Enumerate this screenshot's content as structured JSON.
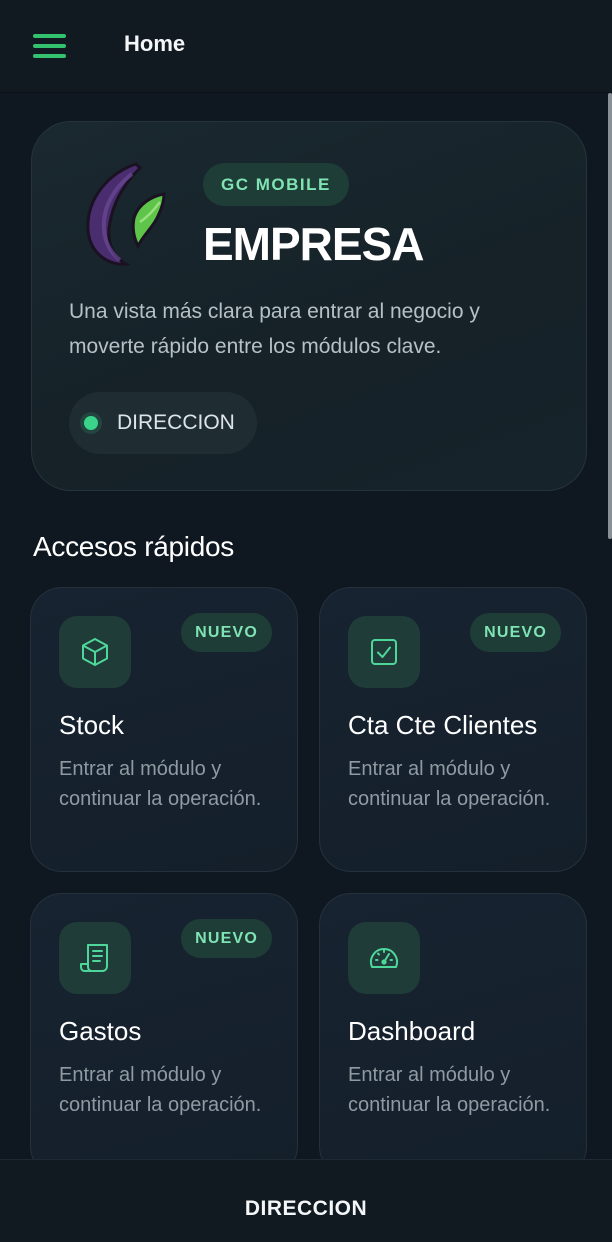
{
  "header": {
    "title": "Home",
    "menu_icon": "hamburger-menu-icon",
    "accent_color": "#33c26d"
  },
  "hero": {
    "logo_icon": "gc-logo",
    "brand_badge": "GC MOBILE",
    "title": "EMPRESA",
    "description": "Una vista más clara para entrar al negocio y moverte rápido entre los módulos clave.",
    "role_label": "DIRECCION",
    "role_status_color": "#3bd38a"
  },
  "quick_access": {
    "title": "Accesos rápidos",
    "cards": [
      {
        "title": "Stock",
        "description": "Entrar al módulo y continuar la operación.",
        "badge": "NUEVO",
        "icon": "box-icon"
      },
      {
        "title": "Cta Cte Clientes",
        "description": "Entrar al módulo y continuar la operación.",
        "badge": "NUEVO",
        "icon": "checkbox-icon"
      },
      {
        "title": "Gastos",
        "description": "Entrar al módulo y continuar la operación.",
        "badge": "NUEVO",
        "icon": "receipt-icon"
      },
      {
        "title": "Dashboard",
        "description": "Entrar al módulo y continuar la operación.",
        "icon": "speedometer-icon"
      }
    ]
  },
  "bottom_bar": {
    "label": "DIRECCION"
  },
  "colors": {
    "background": "#0f1720",
    "badge_bg": "#1f3d37",
    "badge_text": "#7fe3b4",
    "icon_tint": "#4fd69a"
  }
}
